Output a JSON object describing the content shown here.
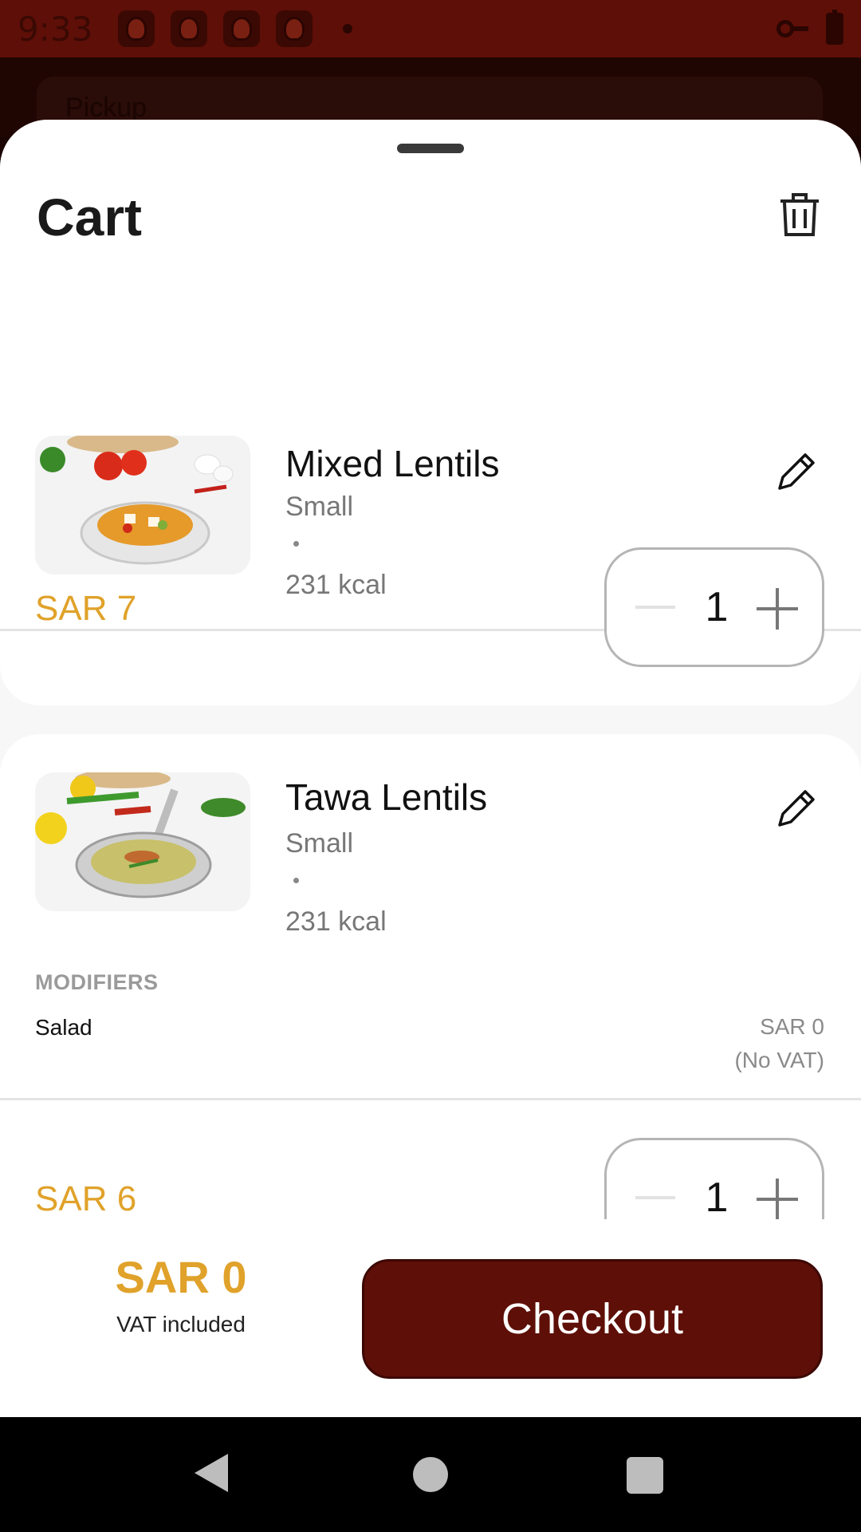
{
  "status_bar": {
    "time": "9:33",
    "notification_icons": [
      "app-mascot-icon",
      "app-mascot-icon",
      "app-mascot-icon",
      "app-mascot-icon"
    ],
    "right_icons": [
      "vpn-key-icon",
      "battery-charging-icon"
    ]
  },
  "background": {
    "pickup_placeholder": "Pickup"
  },
  "cart": {
    "title": "Cart",
    "items": [
      {
        "name": "Mixed Lentils",
        "size": "Small",
        "kcal": "231 kcal",
        "price": "SAR 7",
        "quantity": "1"
      },
      {
        "name": "Tawa Lentils",
        "size": "Small",
        "kcal": "231 kcal",
        "modifiers_label": "MODIFIERS",
        "modifier_name": "Salad",
        "modifier_price": "SAR 0",
        "modifier_vat": "(No VAT)",
        "price": "SAR 6",
        "quantity": "1"
      }
    ]
  },
  "footer": {
    "total": "SAR 0",
    "vat_note": "VAT included",
    "checkout_label": "Checkout"
  },
  "colors": {
    "brand": "#5e0f07",
    "price_accent": "#e0a22a"
  }
}
